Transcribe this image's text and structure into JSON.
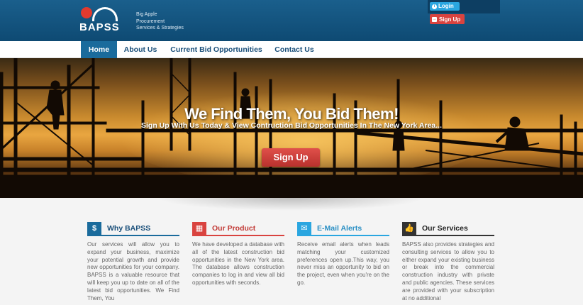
{
  "brand": {
    "logo_text": "BAPSS",
    "tagline": [
      "Big Apple",
      "Procurement",
      "Services & Strategies"
    ]
  },
  "auth": {
    "login_label": "Login",
    "signup_label": "Sign Up"
  },
  "nav": {
    "items": [
      {
        "label": "Home",
        "active": true
      },
      {
        "label": "About Us",
        "active": false
      },
      {
        "label": "Current Bid Opportunities",
        "active": false
      },
      {
        "label": "Contact Us",
        "active": false
      }
    ]
  },
  "hero": {
    "title": "We Find Them, You Bid Them!",
    "subtitle": "Sign Up With Us Today & View Contruction Bid Opportunities In The New York Area...",
    "cta_label": "Sign Up"
  },
  "features": [
    {
      "title": "Why BAPSS",
      "icon": "dollar-icon",
      "icon_glyph": "$",
      "color": "#1a6b9c",
      "underline": "#1a6b9c",
      "body": "Our services will allow you to expand your business, maximize your potential growth and provide new opportunities for your company. BAPSS is a valuable resource that will keep you up to date on all of the latest bid opportunities. We Find Them, You"
    },
    {
      "title": "Our Product",
      "icon": "product-icon",
      "icon_glyph": "▦",
      "color": "#d9433f",
      "underline": "#d9433f",
      "body": "We have developed a database with all of the latest construction bid opportunities in the New York area. The database allows construction companies to log in and view all bid opportunities with seconds."
    },
    {
      "title": "E-Mail Alerts",
      "icon": "envelope-icon",
      "icon_glyph": "✉",
      "color": "#2aa6e0",
      "underline": "#2aa6e0",
      "body": "Receive email alerts when leads matching your customized preferences open up.This way, you never miss an opportunity to bid on the project, even when you're on the go."
    },
    {
      "title": "Our Services",
      "icon": "thumbs-up-icon",
      "icon_glyph": "👍",
      "color": "#333333",
      "underline": "#333333",
      "body": "BAPSS also provides strategies and consulting services to allow you to either expand your existing business or break into the commercial construction industry with private and public agencies. These services are provided with your subscription at no additional"
    }
  ]
}
